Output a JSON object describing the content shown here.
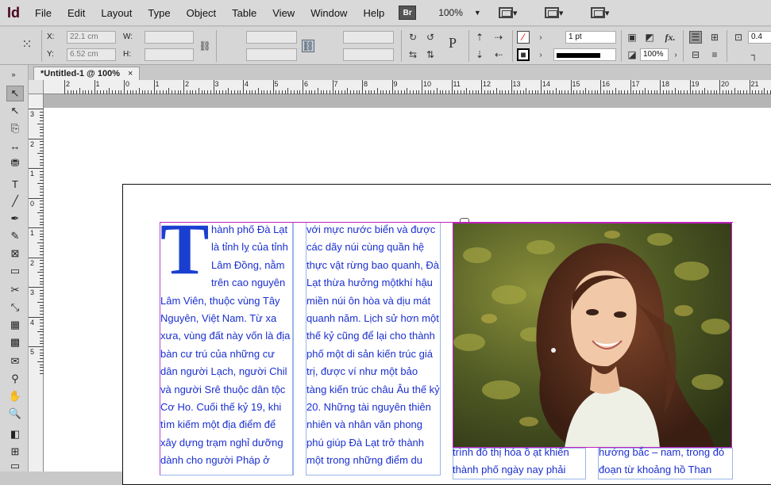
{
  "app": {
    "logo": "Id"
  },
  "menu": [
    "File",
    "Edit",
    "Layout",
    "Type",
    "Object",
    "Table",
    "View",
    "Window",
    "Help"
  ],
  "menubar": {
    "bridge": "Br",
    "zoom": "100%"
  },
  "control": {
    "x_label": "X:",
    "x_value": "22.1 cm",
    "y_label": "Y:",
    "y_value": "6.52 cm",
    "w_label": "W:",
    "h_label": "H:",
    "stroke_weight": "1 pt",
    "opacity": "100%",
    "fx_label": "fx.",
    "p_label": "P",
    "right_value": "0.4"
  },
  "document": {
    "tab_title": "*Untitled-1 @ 100%",
    "close": "×"
  },
  "ruler": {
    "h_ticks": [
      "2",
      "1",
      "0",
      "1",
      "2",
      "3",
      "4",
      "5",
      "6",
      "7",
      "8",
      "9",
      "10",
      "11",
      "12",
      "13",
      "14",
      "15",
      "16",
      "17",
      "18",
      "19",
      "20",
      "21"
    ],
    "v_ticks": [
      "3",
      "2",
      "1",
      "0",
      "1",
      "2",
      "3",
      "4",
      "5"
    ]
  },
  "article": {
    "dropcap": "T",
    "col1": "hành phố Đà Lạt là tỉnh lỵ của tỉnh Lâm Đồng, nằm trên cao nguyên Lâm Viên, thuộc vùng Tây Nguyên, Việt Nam. Từ xa xưa, vùng đất này vốn là địa bàn cư trú của những cư dân người Lạch, người Chil và người Srê thuộc dân tộc Cơ Ho. Cuối thế kỷ 19, khi tìm kiếm một địa điểm để xây dựng trạm nghỉ dưỡng dành cho người Pháp ở Đông Dương",
    "col2": "với mực nước biển và được các dãy núi cùng quần hệ thực vật rừng bao quanh, Đà Lạt thừa hưởng mộtkhí hậu miền núi ôn hòa và dịu mát quanh năm. Lịch sử hơn một thế kỷ cũng để lại cho thành phố một di sản kiến trúc giá trị, được ví như một bảo tàng kiến trúc châu Âu thế kỷ 20. Những tài nguyên thiên nhiên và nhân văn phong phú giúp Đà Lạt trở thành một trong những điểm du lịch nổi tiếng",
    "col3": "trình đô thị hóa ồ ạt khiến thành phố ngày nay phải",
    "col4": "hướng bắc – nam, trong đó đoạn từ khoảng hồ Than"
  }
}
